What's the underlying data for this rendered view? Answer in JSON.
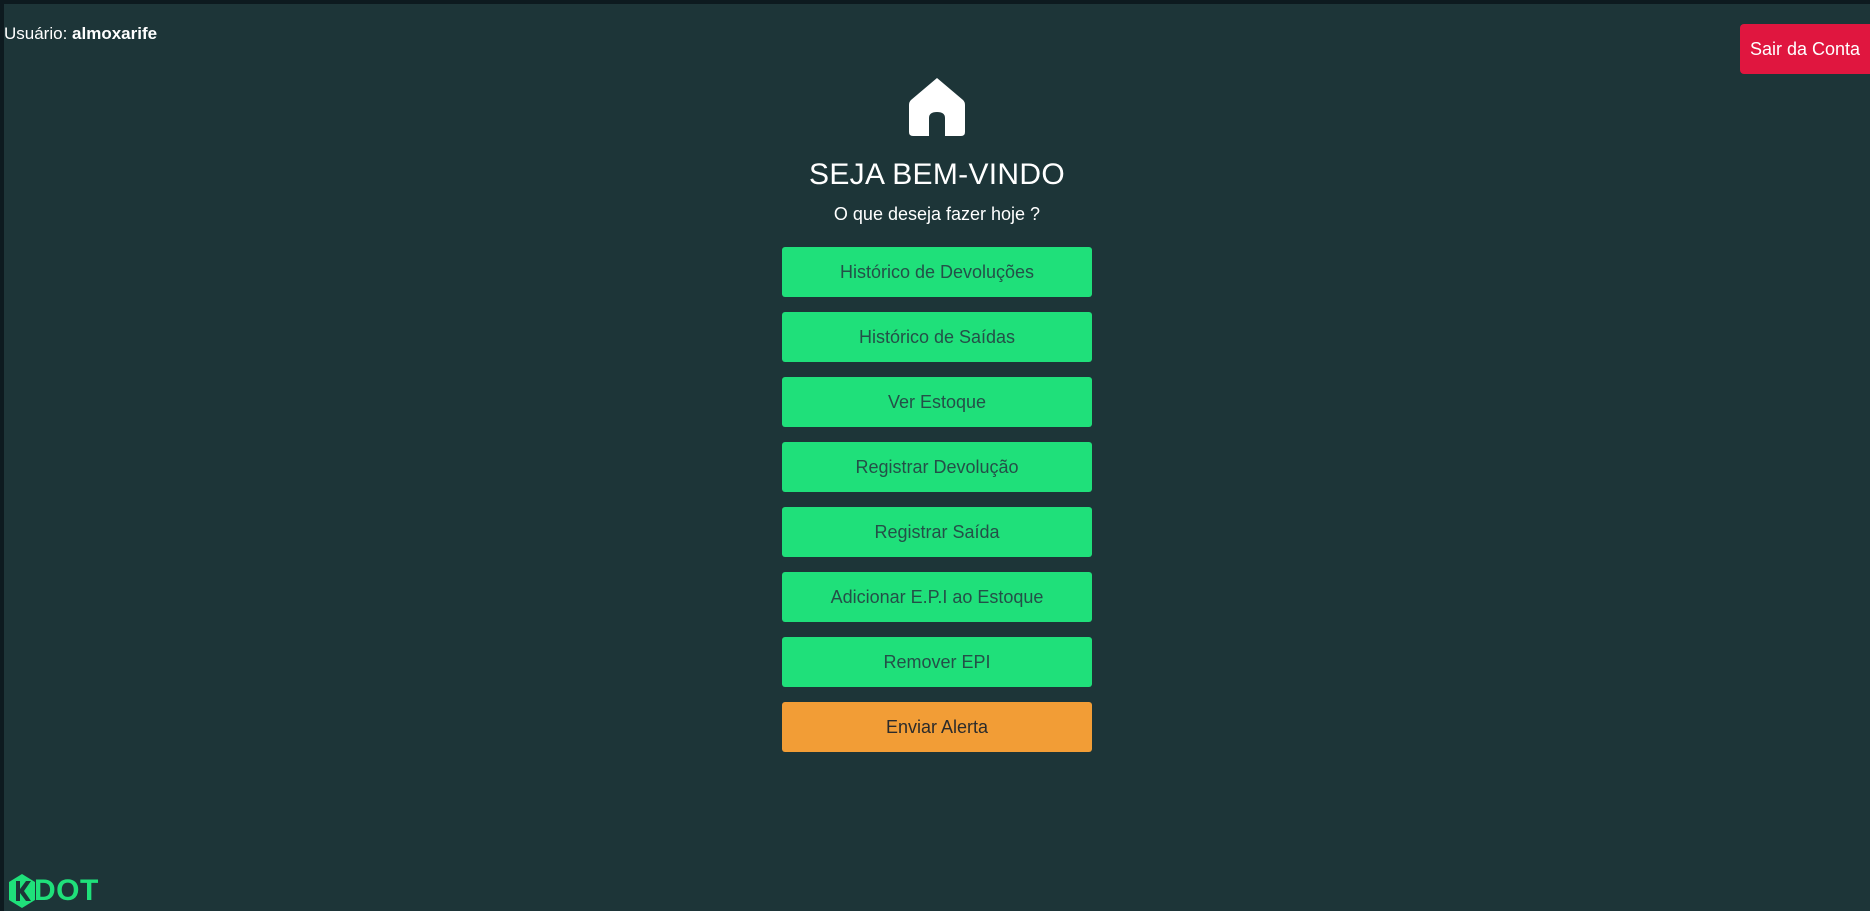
{
  "header": {
    "user_prefix": "Usuário:",
    "username": "almoxarife",
    "logout_label": "Sair da Conta"
  },
  "main": {
    "icon": "home-icon",
    "title": "SEJA BEM-VINDO",
    "subtitle": "O que deseja fazer hoje ?",
    "buttons": [
      {
        "label": "Histórico de Devoluções"
      },
      {
        "label": "Histórico de Saídas"
      },
      {
        "label": "Ver Estoque"
      },
      {
        "label": "Registrar Devolução"
      },
      {
        "label": "Registrar Saída"
      },
      {
        "label": "Adicionar E.P.I ao Estoque"
      },
      {
        "label": "Remover EPI"
      },
      {
        "label": "Enviar Alerta"
      }
    ]
  },
  "footer": {
    "logo_text": "DOT"
  },
  "colors": {
    "background": "#1d3538",
    "primary_button": "#1fe07a",
    "alert_button": "#f29d36",
    "logout_button": "#e0163f"
  }
}
